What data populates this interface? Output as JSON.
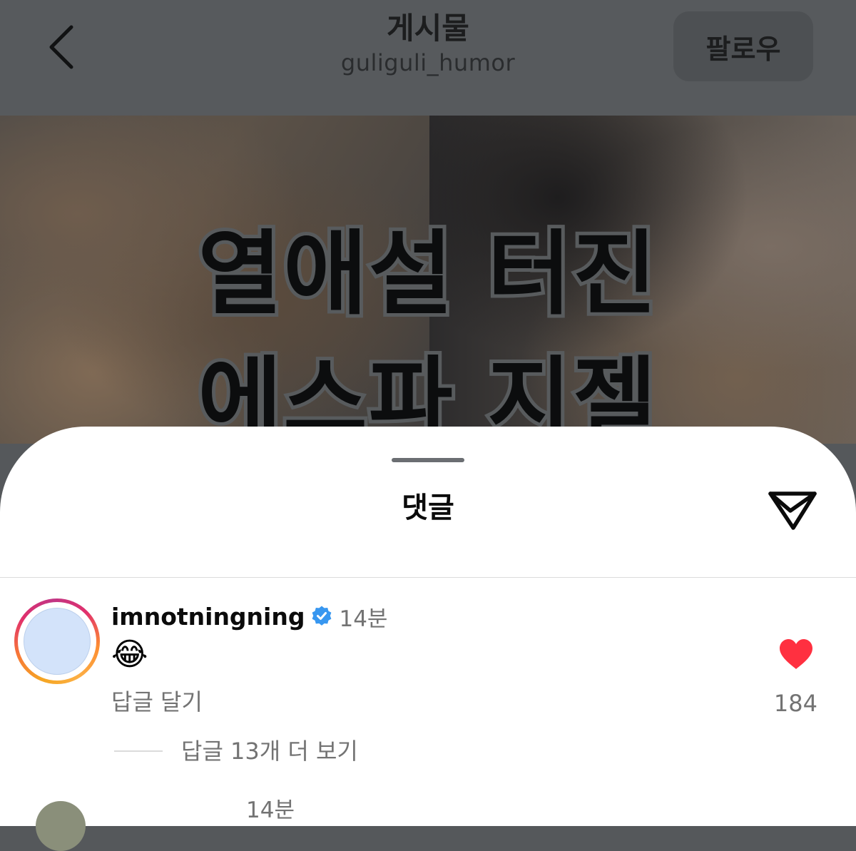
{
  "header": {
    "title": "게시물",
    "username": "guliguli_humor",
    "follow_label": "팔로우"
  },
  "post": {
    "headline_line1": "열애설 터진",
    "headline_line2": "에스파 지젤"
  },
  "comments_sheet": {
    "title": "댓글",
    "comments": [
      {
        "username": "imnotningning",
        "verified": true,
        "time": "14분",
        "text": "😂",
        "reply_label": "답글 달기",
        "like_count": "184",
        "liked": true,
        "view_replies_label": "답글 13개 더 보기"
      },
      {
        "time": "14분"
      }
    ]
  },
  "icons": {
    "back": "chevron-left-icon",
    "share": "paper-plane-icon",
    "verified": "verified-badge-icon",
    "like": "heart-icon"
  },
  "colors": {
    "like_red": "#ff3040",
    "verified_blue": "#3897f0",
    "secondary_text": "#737373"
  }
}
